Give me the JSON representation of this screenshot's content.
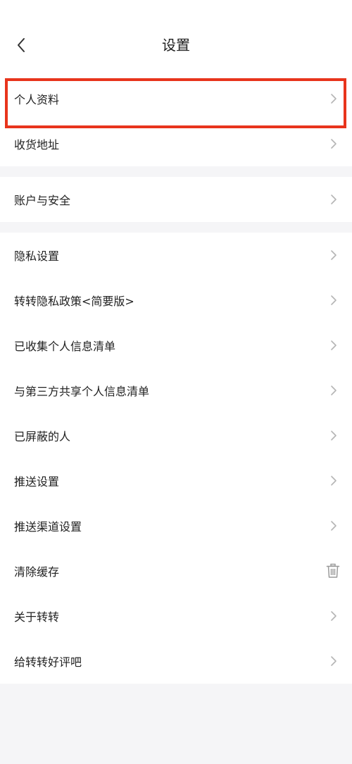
{
  "header": {
    "title": "设置",
    "back_icon": "chevron-left-icon"
  },
  "groups": [
    {
      "items": [
        {
          "label": "个人资料",
          "trailing": "chevron-right-icon"
        },
        {
          "label": "收货地址",
          "trailing": "chevron-right-icon"
        }
      ]
    },
    {
      "items": [
        {
          "label": "账户与安全",
          "trailing": "chevron-right-icon"
        }
      ]
    },
    {
      "items": [
        {
          "label": "隐私设置",
          "trailing": "chevron-right-icon"
        },
        {
          "label": "转转隐私政策<简要版>",
          "trailing": "chevron-right-icon"
        },
        {
          "label": "已收集个人信息清单",
          "trailing": "chevron-right-icon"
        },
        {
          "label": "与第三方共享个人信息清单",
          "trailing": "chevron-right-icon"
        },
        {
          "label": "已屏蔽的人",
          "trailing": "chevron-right-icon"
        },
        {
          "label": "推送设置",
          "trailing": "chevron-right-icon"
        },
        {
          "label": "推送渠道设置",
          "trailing": "chevron-right-icon"
        },
        {
          "label": "清除缓存",
          "trailing": "trash-icon"
        },
        {
          "label": "关于转转",
          "trailing": "chevron-right-icon"
        },
        {
          "label": "给转转好评吧",
          "trailing": "chevron-right-icon"
        }
      ]
    }
  ],
  "colors": {
    "background": "#f5f5f7",
    "surface": "#ffffff",
    "text": "#222222",
    "icon": "#b5b5b5",
    "highlight": "#e8341c"
  }
}
